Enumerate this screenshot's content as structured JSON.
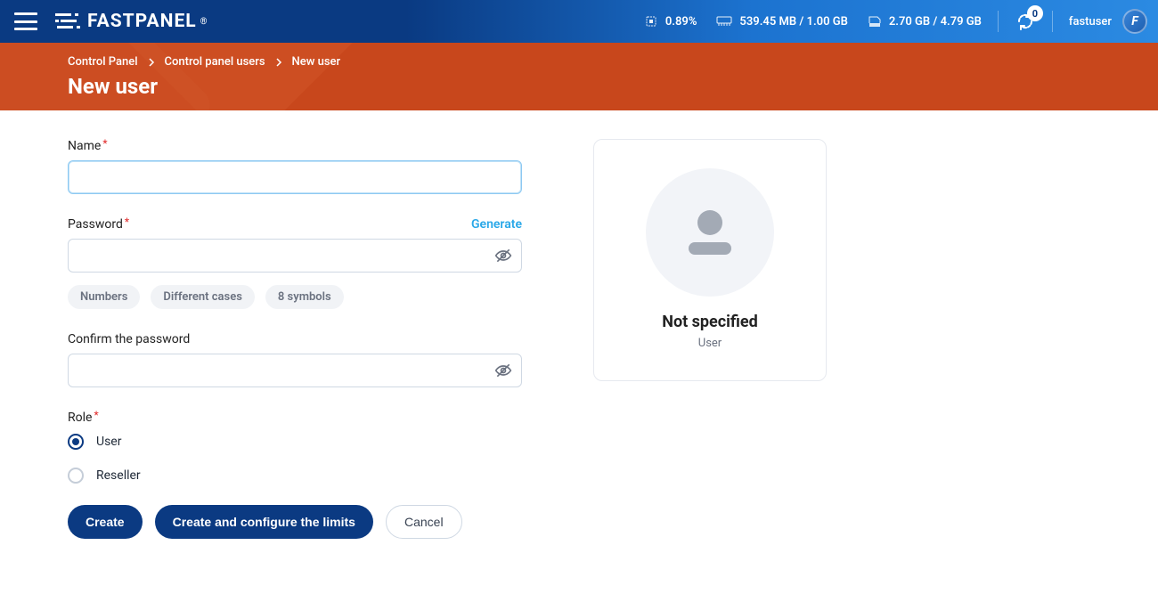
{
  "header": {
    "logo_text": "FASTPANEL",
    "stats": {
      "cpu": "0.89%",
      "ram": "539.45 MB / 1.00 GB",
      "disk": "2.70 GB / 4.79 GB"
    },
    "notifications": "0",
    "username": "fastuser",
    "avatar_initial": "F"
  },
  "breadcrumb": {
    "items": [
      "Control Panel",
      "Control panel users",
      "New user"
    ]
  },
  "page": {
    "title": "New user"
  },
  "form": {
    "name": {
      "label": "Name",
      "value": ""
    },
    "password": {
      "label": "Password",
      "generate": "Generate",
      "value": ""
    },
    "password_hints": [
      "Numbers",
      "Different cases",
      "8 symbols"
    ],
    "confirm": {
      "label": "Confirm the password",
      "value": ""
    },
    "role": {
      "label": "Role",
      "options": [
        {
          "key": "user",
          "label": "User",
          "checked": true
        },
        {
          "key": "reseller",
          "label": "Reseller",
          "checked": false
        }
      ]
    },
    "actions": {
      "create": "Create",
      "create_limits": "Create and configure the limits",
      "cancel": "Cancel"
    }
  },
  "card": {
    "name": "Not specified",
    "role": "User"
  }
}
